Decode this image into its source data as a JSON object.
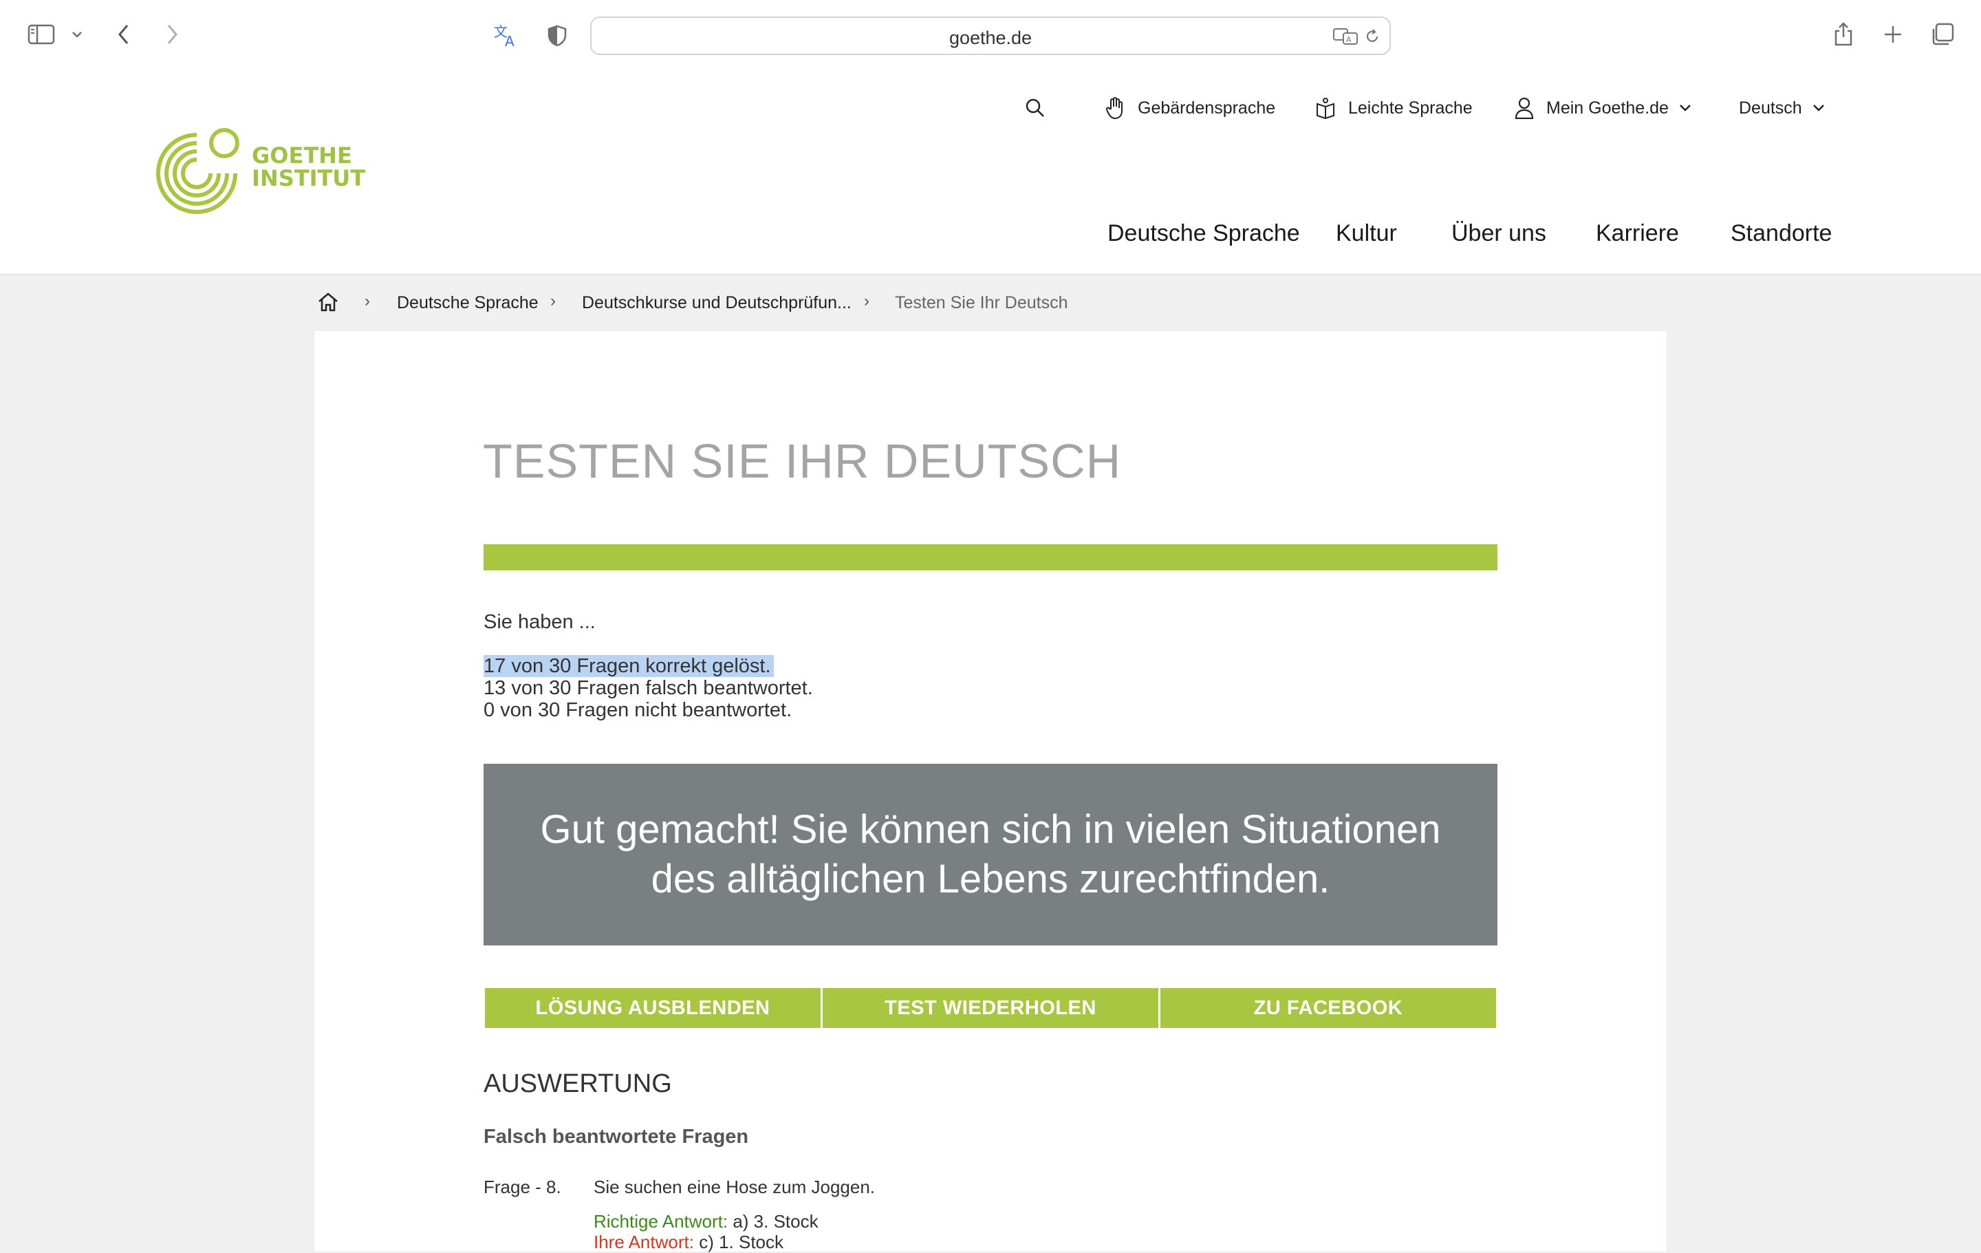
{
  "browser": {
    "url": "goethe.de"
  },
  "header": {
    "logo_line1": "GOETHE",
    "logo_line2": "INSTITUT",
    "util": {
      "sign_language": "Gebärdensprache",
      "easy_language": "Leichte Sprache",
      "account": "Mein Goethe.de",
      "language": "Deutsch"
    },
    "nav": [
      "Deutsche Sprache",
      "Kultur",
      "Über uns",
      "Karriere",
      "Standorte"
    ]
  },
  "breadcrumb": [
    "Deutsche Sprache",
    "Deutschkurse und Deutschprüfun...",
    "Testen Sie Ihr Deutsch"
  ],
  "main": {
    "title": "TESTEN SIE IHR DEUTSCH",
    "intro": "Sie haben ...",
    "result_correct": "17 von 30 Fragen korrekt gelöst.",
    "result_wrong": "13 von 30 Fragen falsch beantwortet.",
    "result_unanswered": "0 von 30 Fragen nicht beantwortet.",
    "feedback": "Gut gemacht! Sie können sich in vielen Situationen des alltäglichen Lebens zurechtfinden.",
    "buttons": {
      "hide_solution": "LÖSUNG AUSBLENDEN",
      "repeat_test": "TEST WIEDERHOLEN",
      "facebook": "ZU FACEBOOK"
    },
    "evaluation_heading": "AUSWERTUNG",
    "wrong_heading": "Falsch beantwortete Fragen",
    "question": {
      "label": "Frage - 8.",
      "text": "Sie suchen eine Hose zum Joggen.",
      "correct_label": "Richtige Antwort:",
      "correct_value": "a) 3. Stock",
      "your_label": "Ihre Antwort:",
      "your_value": "c) 1. Stock"
    }
  },
  "colors": {
    "brand_green": "#a8c63f",
    "feedback_gray": "#7a7f82",
    "title_gray": "#a4a4a4"
  }
}
